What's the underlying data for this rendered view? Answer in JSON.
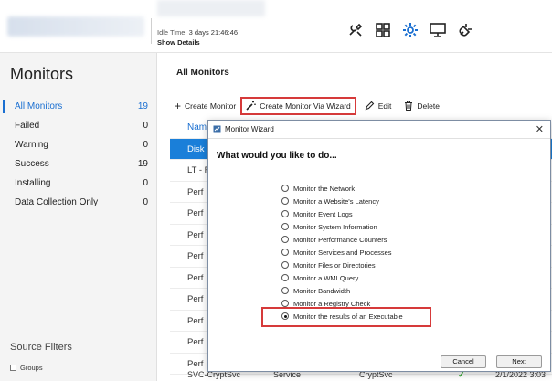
{
  "header": {
    "idle_label": "Idle Time:",
    "idle_value": "3 days 21:46:46",
    "show_details": "Show Details"
  },
  "sidebar": {
    "title": "Monitors",
    "items": [
      {
        "label": "All Monitors",
        "count": "19"
      },
      {
        "label": "Failed",
        "count": "0"
      },
      {
        "label": "Warning",
        "count": "0"
      },
      {
        "label": "Success",
        "count": "19"
      },
      {
        "label": "Installing",
        "count": "0"
      },
      {
        "label": "Data Collection Only",
        "count": "0"
      }
    ],
    "source_filters": "Source Filters",
    "filter_groups": "Groups"
  },
  "main": {
    "title": "All Monitors",
    "toolbar": {
      "create": "Create Monitor",
      "wizard": "Create Monitor Via Wizard",
      "edit": "Edit",
      "delete": "Delete"
    },
    "rows": [
      "Nam",
      "Disk",
      "LT - F",
      "Perf",
      "Perf",
      "Perf",
      "Perf",
      "Perf",
      "Perf",
      "Perf",
      "Perf",
      "Perf"
    ],
    "bottom_row": {
      "name": "SVC-CryptSvc",
      "type": "Service",
      "target": "CryptSvc",
      "date": "2/1/2022 3:03"
    }
  },
  "dialog": {
    "title": "Monitor Wizard",
    "question": "What would you like to do...",
    "options": [
      "Monitor the Network",
      "Monitor a Website's Latency",
      "Monitor Event Logs",
      "Monitor System Information",
      "Monitor Performance Counters",
      "Monitor Services and Processes",
      "Monitor Files or Directories",
      "Monitor a WMI Query",
      "Monitor Bandwidth",
      "Monitor a Registry Check",
      "Monitor the results of an Executable"
    ],
    "selected_index": 10,
    "cancel": "Cancel",
    "next": "Next"
  },
  "colors": {
    "accent": "#1a6fd1",
    "highlight": "#d63a3a",
    "selected_row": "#1a7fd9"
  }
}
